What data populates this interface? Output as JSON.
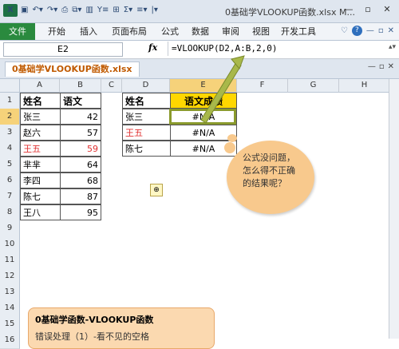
{
  "app": {
    "title": "0基础学VLOOKUP函数.xlsx M...",
    "logo": "X",
    "qat_icons": [
      "save-icon",
      "undo-icon",
      "redo-icon",
      "print-preview-icon",
      "format-painter-icon",
      "chart-icon",
      "filter-icon",
      "table-icon",
      "autosum-icon",
      "align-icon",
      "dropdown-icon"
    ],
    "win_buttons": [
      "—",
      "▫",
      "✕"
    ]
  },
  "ribbon": {
    "file": "文件",
    "tabs": [
      "开始",
      "插入",
      "页面布局",
      "公式",
      "数据",
      "审阅",
      "视图",
      "开发工具"
    ],
    "right_icons": [
      "♡",
      "?",
      "—",
      "▫",
      "✕"
    ]
  },
  "formula_bar": {
    "name_box": "E2",
    "fx": "fx",
    "formula": "=VLOOKUP(D2,A:B,2,0)"
  },
  "workbook": {
    "tab": "0基础学VLOOKUP函数.xlsx"
  },
  "grid": {
    "columns": [
      "A",
      "B",
      "C",
      "D",
      "E",
      "F",
      "G",
      "H"
    ],
    "rows": [
      "1",
      "2",
      "3",
      "4",
      "5",
      "6",
      "7",
      "8",
      "9",
      "10",
      "11",
      "12",
      "13",
      "14",
      "15",
      "16"
    ],
    "table1": {
      "headers": [
        "姓名",
        "语文"
      ],
      "rows": [
        {
          "name": "张三",
          "score": "42",
          "red": false
        },
        {
          "name": "赵六",
          "score": "57",
          "red": false
        },
        {
          "name": "王五",
          "score": "59",
          "red": true
        },
        {
          "name": "芈芈",
          "score": "64",
          "red": false
        },
        {
          "name": "李四",
          "score": "68",
          "red": false
        },
        {
          "name": "陈七",
          "score": "87",
          "red": false
        },
        {
          "name": "王八",
          "score": "95",
          "red": false
        }
      ]
    },
    "table2": {
      "headers": [
        "姓名",
        "语文成绩"
      ],
      "rows": [
        {
          "name": "张三",
          "result": "#N/A",
          "red": false
        },
        {
          "name": "王五",
          "result": "#N/A",
          "red": true
        },
        {
          "name": "陈七",
          "result": "#N/A",
          "red": false
        }
      ]
    }
  },
  "callout": {
    "text": "公式没问题，怎么得不正确的结果呢？"
  },
  "note": {
    "title": "0基础学函数-VLOOKUP函数",
    "subtitle": "错误处理（1）-看不见的空格"
  },
  "colors": {
    "file_tab": "#2a8a3e",
    "header_fill": "#ffd700",
    "highlight_border": "#8a9a2c",
    "bubble": "#f8c98d"
  }
}
